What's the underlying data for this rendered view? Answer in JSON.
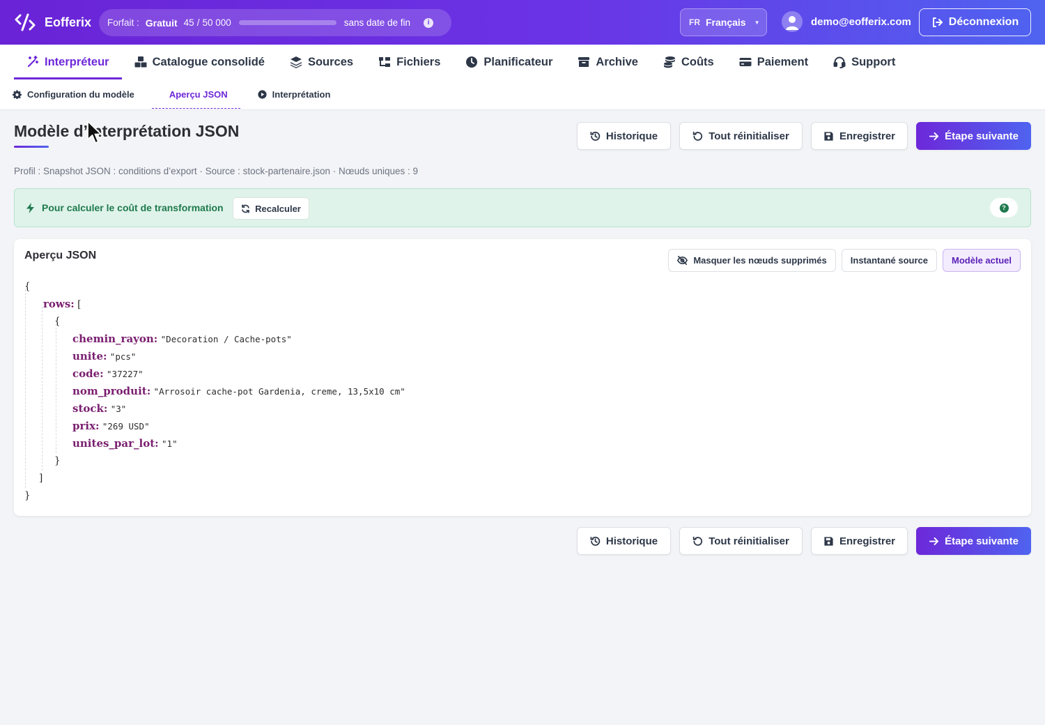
{
  "header": {
    "app_name": "Eofferix",
    "plan": {
      "label": "Forfait :",
      "name": "Gratuit",
      "used": "45",
      "sep": "/",
      "total": "50 000",
      "usage_fraction": 0.0009,
      "expiry": "sans date de fin"
    },
    "language": {
      "code": "FR",
      "label": "Français"
    },
    "user_email": "demo@eofferix.com",
    "logout_label": "Déconnexion"
  },
  "main_nav": {
    "items": [
      {
        "label": "Interpréteur",
        "icon": "magic-wand-icon",
        "active": true
      },
      {
        "label": "Catalogue consolidé",
        "icon": "boxes-icon"
      },
      {
        "label": "Sources",
        "icon": "layers-icon"
      },
      {
        "label": "Fichiers",
        "icon": "file-tree-icon"
      },
      {
        "label": "Planificateur",
        "icon": "clock-icon"
      },
      {
        "label": "Archive",
        "icon": "archive-icon"
      },
      {
        "label": "Coûts",
        "icon": "coins-icon"
      },
      {
        "label": "Paiement",
        "icon": "credit-card-icon"
      },
      {
        "label": "Support",
        "icon": "headset-icon"
      }
    ]
  },
  "sub_nav": {
    "items": [
      {
        "label": "Configuration du modèle",
        "icon": "gear-icon"
      },
      {
        "label": "Aperçu JSON",
        "active": true
      },
      {
        "label": "Interprétation",
        "icon": "play-circle-icon"
      }
    ]
  },
  "page": {
    "title": "Modèle d’interprétation JSON",
    "meta": "Profil : Snapshot JSON : conditions d’export · Source : stock-partenaire.json · Nœuds uniques : 9",
    "actions": {
      "history": "Historique",
      "reset": "Tout réinitialiser",
      "save": "Enregistrer",
      "next": "Étape suivante"
    }
  },
  "notice": {
    "text": "Pour calculer le coût de transformation",
    "button": "Recalculer",
    "help": "?"
  },
  "preview": {
    "title": "Aperçu JSON",
    "tools": {
      "hide_deleted": "Masquer les nœuds supprimés",
      "source_snapshot": "Instantané source",
      "current_model": "Modèle actuel"
    },
    "json": {
      "open": "{",
      "rows_key": "rows:",
      "rows_open": "[",
      "obj_open": "{",
      "fields": [
        {
          "key": "chemin_rayon:",
          "value": "\"Decoration / Cache-pots\""
        },
        {
          "key": "unite:",
          "value": "\"pcs\""
        },
        {
          "key": "code:",
          "value": "\"37227\""
        },
        {
          "key": "nom_produit:",
          "value": "\"Arrosoir cache-pot Gardenia, creme, 13,5x10 cm\""
        },
        {
          "key": "stock:",
          "value": "\"3\""
        },
        {
          "key": "prix:",
          "value": "\"269 USD\""
        },
        {
          "key": "unites_par_lot:",
          "value": "\"1\""
        }
      ],
      "obj_close": "}",
      "rows_close": "]",
      "close": "}"
    }
  },
  "colors": {
    "accent": "#6d28d9",
    "accent2": "#4f63f0",
    "notice_bg": "#dff3ea",
    "notice_text": "#1f7a4d",
    "json_key": "#7a1e6f"
  }
}
